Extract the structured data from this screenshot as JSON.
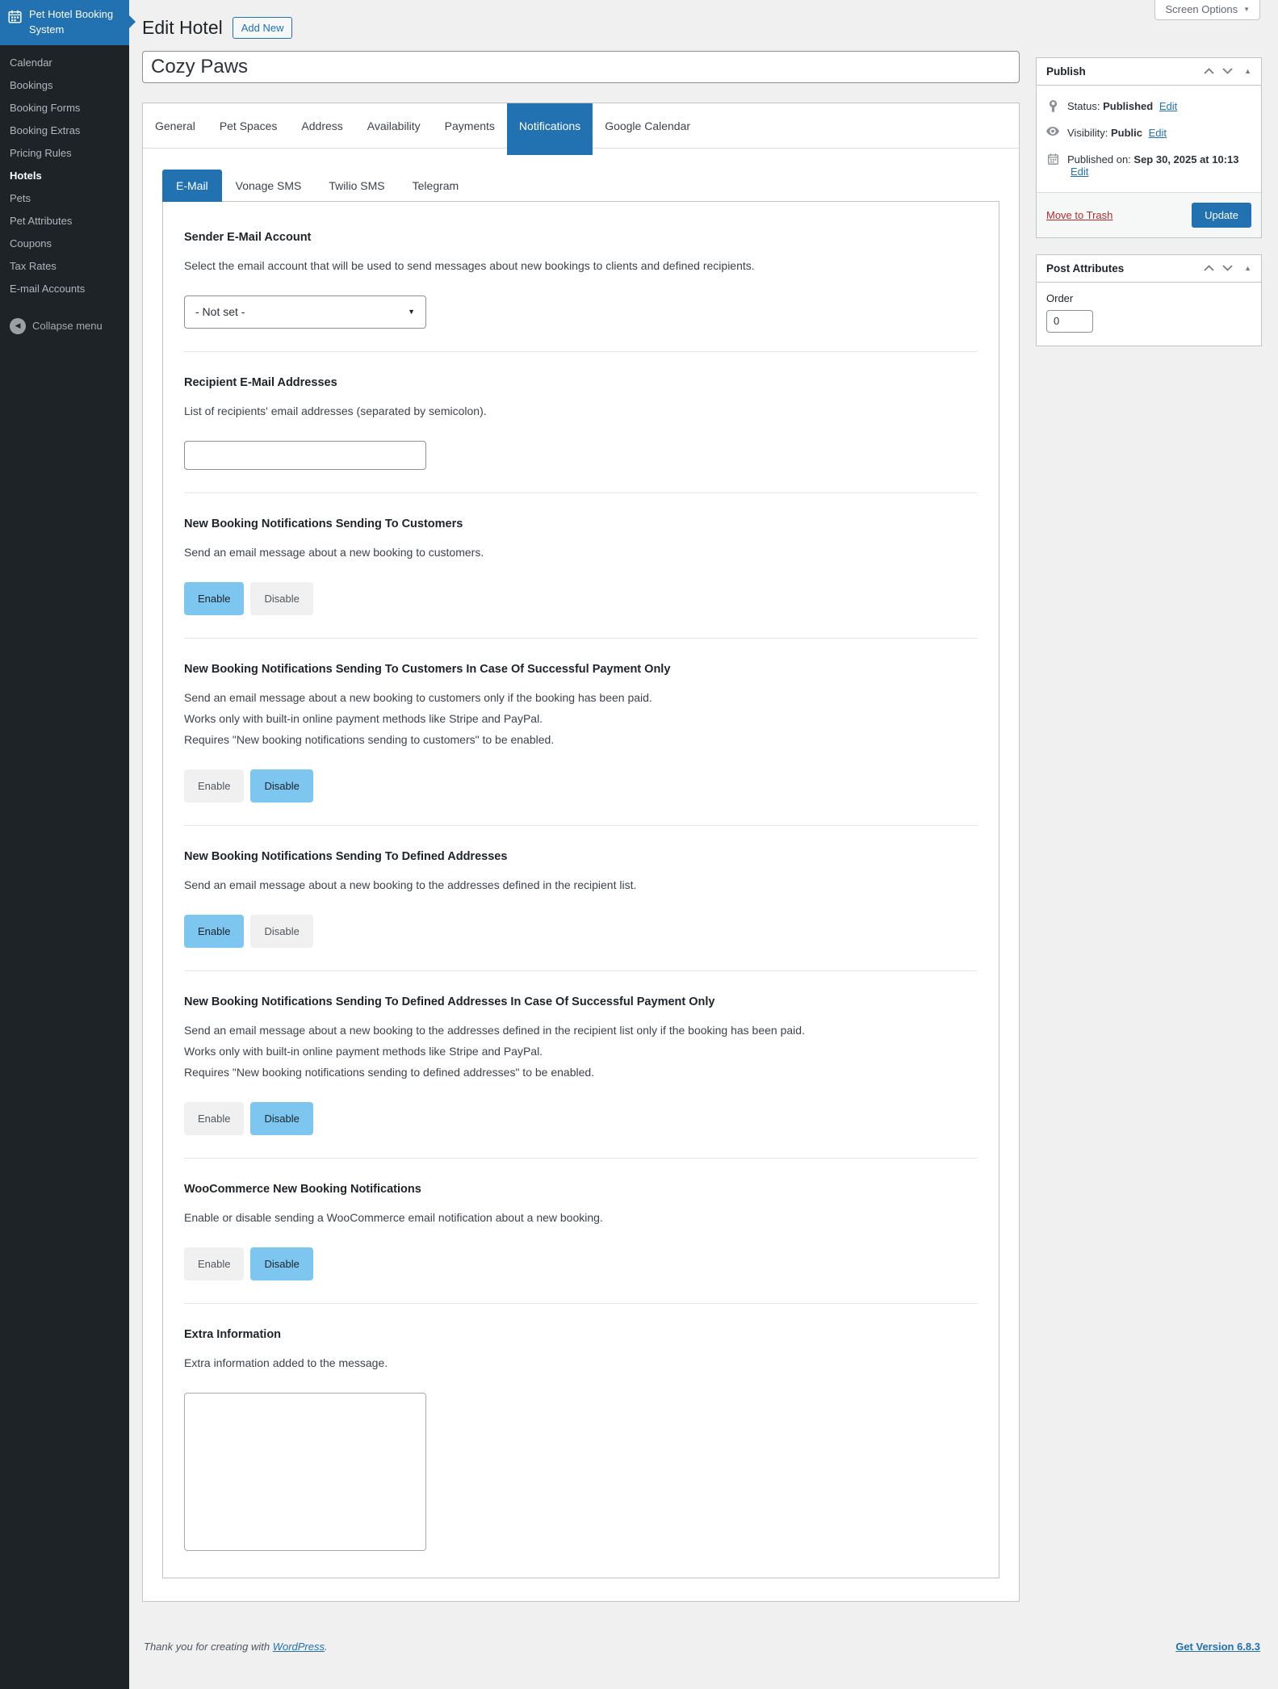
{
  "colors": {
    "accent_blue": "#2271b1",
    "sidebar_bg": "#1d2327",
    "toggle_active": "#7cc6f0",
    "trash_red": "#b32d2e",
    "page_bg": "#f0f0f1"
  },
  "sidebar": {
    "app_title": "Pet Hotel Booking System",
    "items": [
      {
        "label": "Calendar",
        "current": false
      },
      {
        "label": "Bookings",
        "current": false
      },
      {
        "label": "Booking Forms",
        "current": false
      },
      {
        "label": "Booking Extras",
        "current": false
      },
      {
        "label": "Pricing Rules",
        "current": false
      },
      {
        "label": "Hotels",
        "current": true
      },
      {
        "label": "Pets",
        "current": false
      },
      {
        "label": "Pet Attributes",
        "current": false
      },
      {
        "label": "Coupons",
        "current": false
      },
      {
        "label": "Tax Rates",
        "current": false
      },
      {
        "label": "E-mail Accounts",
        "current": false
      }
    ],
    "collapse_label": "Collapse menu"
  },
  "header": {
    "page_title": "Edit Hotel",
    "add_new_label": "Add New",
    "screen_options_label": "Screen Options"
  },
  "title_field": {
    "value": "Cozy Paws"
  },
  "tabs": {
    "items": [
      {
        "label": "General",
        "active": false
      },
      {
        "label": "Pet Spaces",
        "active": false
      },
      {
        "label": "Address",
        "active": false
      },
      {
        "label": "Availability",
        "active": false
      },
      {
        "label": "Payments",
        "active": false
      },
      {
        "label": "Notifications",
        "active": true
      },
      {
        "label": "Google Calendar",
        "active": false
      }
    ]
  },
  "subtabs": {
    "items": [
      {
        "label": "E-Mail",
        "active": true
      },
      {
        "label": "Vonage SMS",
        "active": false
      },
      {
        "label": "Twilio SMS",
        "active": false
      },
      {
        "label": "Telegram",
        "active": false
      }
    ]
  },
  "controls": {
    "enable_label": "Enable",
    "disable_label": "Disable"
  },
  "sections": [
    {
      "heading": "Sender E-Mail Account",
      "description": [
        "Select the email account that will be used to send messages about new bookings to clients and defined recipients."
      ],
      "control": "select",
      "value": "- Not set -"
    },
    {
      "heading": "Recipient E-Mail Addresses",
      "description": [
        "List of recipients' email addresses (separated by semicolon)."
      ],
      "control": "input",
      "value": ""
    },
    {
      "heading": "New Booking Notifications Sending To Customers",
      "description": [
        "Send an email message about a new booking to customers."
      ],
      "control": "toggle",
      "state": "enable"
    },
    {
      "heading": "New Booking Notifications Sending To Customers In Case Of Successful Payment Only",
      "description": [
        "Send an email message about a new booking to customers only if the booking has been paid.",
        "Works only with built-in online payment methods like Stripe and PayPal.",
        "Requires \"New booking notifications sending to customers\" to be enabled."
      ],
      "control": "toggle",
      "state": "disable"
    },
    {
      "heading": "New Booking Notifications Sending To Defined Addresses",
      "description": [
        "Send an email message about a new booking to the addresses defined in the recipient list."
      ],
      "control": "toggle",
      "state": "enable"
    },
    {
      "heading": "New Booking Notifications Sending To Defined Addresses In Case Of Successful Payment Only",
      "description": [
        "Send an email message about a new booking to the addresses defined in the recipient list only if the booking has been paid.",
        "Works only with built-in online payment methods like Stripe and PayPal.",
        "Requires \"New booking notifications sending to defined addresses\" to be enabled."
      ],
      "control": "toggle",
      "state": "disable"
    },
    {
      "heading": "WooCommerce New Booking Notifications",
      "description": [
        "Enable or disable sending a WooCommerce email notification about a new booking."
      ],
      "control": "toggle",
      "state": "disable"
    },
    {
      "heading": "Extra Information",
      "description": [
        "Extra information added to the message."
      ],
      "control": "textarea",
      "value": ""
    }
  ],
  "publish_panel": {
    "title": "Publish",
    "status_label": "Status:",
    "status_value": "Published",
    "visibility_label": "Visibility:",
    "visibility_value": "Public",
    "published_label": "Published on:",
    "published_value": "Sep 30, 2025 at 10:13",
    "edit_label": "Edit",
    "trash_label": "Move to Trash",
    "update_label": "Update"
  },
  "post_attributes_panel": {
    "title": "Post Attributes",
    "order_label": "Order",
    "order_value": "0"
  },
  "footer": {
    "thanks_prefix": "Thank you for creating with ",
    "thanks_link": "WordPress",
    "thanks_suffix": ".",
    "version_link": "Get Version 6.8.3"
  }
}
